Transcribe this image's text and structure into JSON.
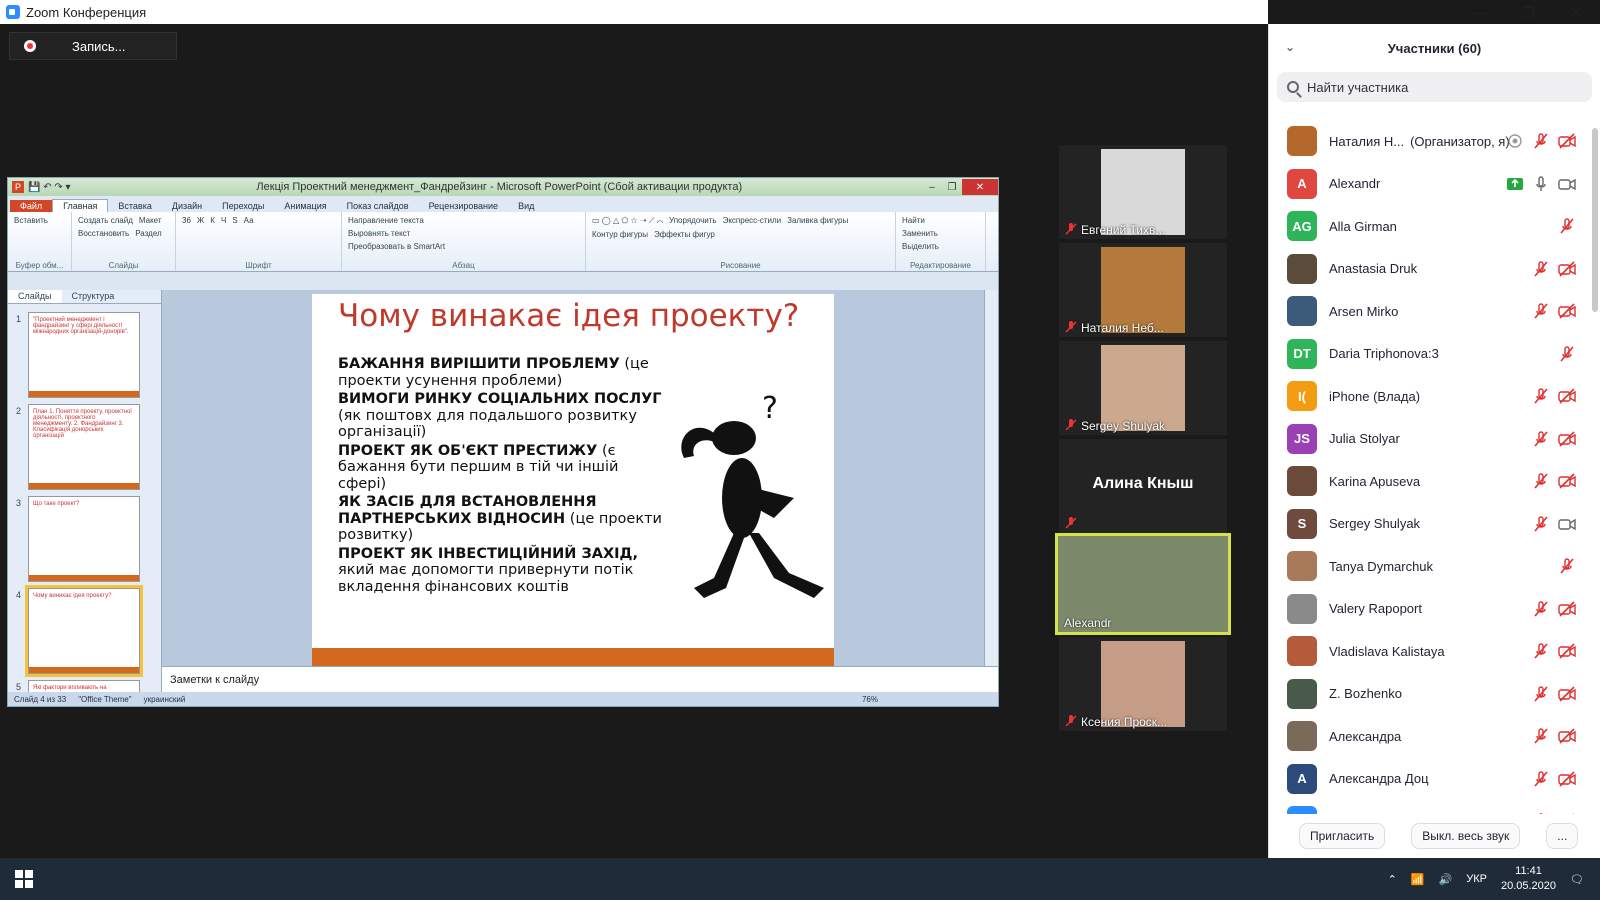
{
  "window": {
    "title": "Zoom Конференция"
  },
  "recording": {
    "label": "Запись..."
  },
  "ppt": {
    "title": "Лекція Проектний менеджмент_Фандрейзинг - Microsoft PowerPoint (Сбой активации продукта)",
    "tabs": [
      "Файл",
      "Главная",
      "Вставка",
      "Дизайн",
      "Переходы",
      "Анимация",
      "Показ слайдов",
      "Рецензирование",
      "Вид"
    ],
    "groups": [
      {
        "label": "Буфер обм...",
        "items": [
          "Вставить"
        ]
      },
      {
        "label": "Слайды",
        "items": [
          "Создать слайд",
          "Макет",
          "Восстановить",
          "Раздел"
        ]
      },
      {
        "label": "Шрифт",
        "items": [
          "36",
          "Ж",
          "К",
          "Ч",
          "S",
          "Аа"
        ]
      },
      {
        "label": "Абзац",
        "items": [
          "Направление текста",
          "Выровнять текст",
          "Преобразовать в SmartArt"
        ]
      },
      {
        "label": "Рисование",
        "items": [
          "Упорядочить",
          "Экспресс-стили",
          "Заливка фигуры",
          "Контур фигуры",
          "Эффекты фигур"
        ]
      },
      {
        "label": "Редактирование",
        "items": [
          "Найти",
          "Заменить",
          "Выделить"
        ]
      }
    ],
    "pane_tabs": [
      "Слайды",
      "Структура"
    ],
    "thumbs": [
      {
        "num": "1",
        "text": "\"Проектний менеджмент і фандрайзинг у сфері діяльності міжнародних організацій-донорів\"."
      },
      {
        "num": "2",
        "text": "План 1. Поняття проекту, проектної діяльності, проектного менеджменту. 2. Фандрайзинг 3. Класифікація донорських організацій"
      },
      {
        "num": "3",
        "text": "Що таке проект?"
      },
      {
        "num": "4",
        "text": "Чому виникає ідея проекту?"
      },
      {
        "num": "5",
        "text": "Які фактори впливають на"
      }
    ],
    "slide": {
      "title": "Чому винакає ідея проекту?",
      "items": [
        {
          "bold": "БАЖАННЯ ВИРІШИТИ ПРОБЛЕМУ",
          "rest": " (це проекти усунення проблеми)"
        },
        {
          "bold": "ВИМОГИ РИНКУ СОЦІАЛЬНИХ ПОСЛУГ",
          "rest": " (як поштовх для подальшого розвитку організації)"
        },
        {
          "bold": "ПРОЕКТ ЯК ОБ'ЄКТ ПРЕСТИЖУ",
          "rest": " (є бажання бути першим в тій чи іншій сфері)"
        },
        {
          "bold": "ЯК ЗАСІБ ДЛЯ ВСТАНОВЛЕННЯ ПАРТНЕРСЬКИХ ВІДНОСИН",
          "rest": " (це проекти розвитку)"
        },
        {
          "bold": "ПРОЕКТ ЯК ІНВЕСТИЦІЙНИЙ ЗАХІД,",
          "rest": " який має допомогти привернути потік вкладення фінансових коштів"
        }
      ]
    },
    "notes": "Заметки к слайду",
    "status": {
      "slide": "Слайд 4 из 33",
      "theme": "\"Office Theme\"",
      "lang": "украинский",
      "zoom": "76%"
    }
  },
  "tiles": [
    {
      "name": "Евгений Тихв...",
      "bg": "#d9d9d9"
    },
    {
      "name": "Наталия Неб...",
      "bg": "#b47a3c"
    },
    {
      "name": "Sergey Shulyak",
      "bg": "#caa98f"
    },
    {
      "name": "Алина Кныш"
    },
    {
      "name": "Alexandr",
      "bg": "#7c8a6b"
    },
    {
      "name": "Ксения Проск...",
      "bg": "#c59c86"
    }
  ],
  "panel": {
    "title": "Участники (60)",
    "search_placeholder": "Найти участника",
    "participants": [
      {
        "name": "Наталия Н...",
        "note": "(Организатор, я)",
        "initials": "",
        "color": "#b4682c",
        "icons": [
          "record",
          "mic-off",
          "video-off"
        ]
      },
      {
        "name": "Alexandr",
        "initials": "A",
        "color": "#e0473f",
        "icons": [
          "share",
          "mic",
          "video"
        ]
      },
      {
        "name": "Alla Girman",
        "initials": "AG",
        "color": "#2fb45a",
        "icons": [
          "mic-off"
        ]
      },
      {
        "name": "Anastasia Druk",
        "initials": "",
        "color": "#5b4b3a",
        "icons": [
          "mic-off",
          "video-off"
        ]
      },
      {
        "name": "Arsen Mirko",
        "initials": "",
        "color": "#3c5a7a",
        "icons": [
          "mic-off",
          "video-off"
        ]
      },
      {
        "name": "Daria Triphonova:3",
        "initials": "DT",
        "color": "#2fb45a",
        "icons": [
          "mic-off"
        ]
      },
      {
        "name": "iPhone (Влада)",
        "initials": "I(",
        "color": "#f39c12",
        "icons": [
          "mic-off",
          "video-off"
        ]
      },
      {
        "name": "Julia Stolyar",
        "initials": "JS",
        "color": "#9b3fb5",
        "icons": [
          "mic-off",
          "video-off"
        ]
      },
      {
        "name": "Karina Apuseva",
        "initials": "",
        "color": "#6b4a3a",
        "icons": [
          "mic-off",
          "video-off"
        ]
      },
      {
        "name": "Sergey Shulyak",
        "initials": "S",
        "color": "#6e4a3f",
        "icons": [
          "mic-off",
          "video"
        ]
      },
      {
        "name": "Tanya Dymarchuk",
        "initials": "",
        "color": "#a87a5a",
        "icons": [
          "mic-off"
        ]
      },
      {
        "name": "Valery Rapoport",
        "initials": "",
        "color": "#8a8a8a",
        "icons": [
          "mic-off",
          "video-off"
        ]
      },
      {
        "name": "Vladislava Kalistaya",
        "initials": "",
        "color": "#b55a3a",
        "icons": [
          "mic-off",
          "video-off"
        ]
      },
      {
        "name": "Z. Bozhenko",
        "initials": "",
        "color": "#4a5a4a",
        "icons": [
          "mic-off",
          "video-off"
        ]
      },
      {
        "name": "Александра",
        "initials": "",
        "color": "#7a6a5a",
        "icons": [
          "mic-off",
          "video-off"
        ]
      },
      {
        "name": "Александра Доц",
        "initials": "A",
        "color": "#2c4a7a",
        "icons": [
          "mic-off",
          "video-off"
        ]
      },
      {
        "name": "",
        "initials": "",
        "color": "#2d8cff",
        "icons": [
          "mic-off",
          "video-off"
        ]
      }
    ],
    "buttons": {
      "invite": "Пригласить",
      "mute_all": "Выкл. весь звук",
      "more": "..."
    }
  },
  "taskbar": {
    "lang": "УКР",
    "time": "11:41",
    "date": "20.05.2020"
  }
}
